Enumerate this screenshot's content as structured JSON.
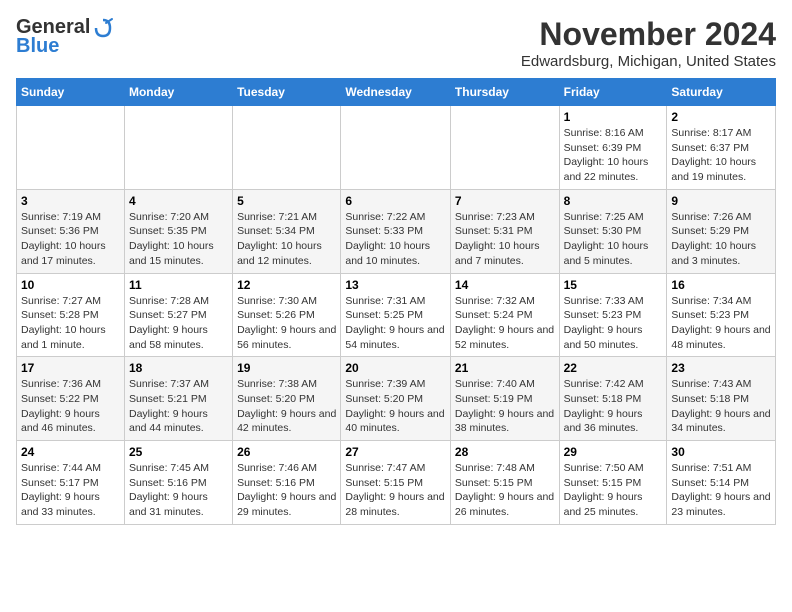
{
  "logo": {
    "general": "General",
    "blue": "Blue"
  },
  "title": "November 2024",
  "location": "Edwardsburg, Michigan, United States",
  "days_of_week": [
    "Sunday",
    "Monday",
    "Tuesday",
    "Wednesday",
    "Thursday",
    "Friday",
    "Saturday"
  ],
  "weeks": [
    [
      {
        "day": "",
        "info": ""
      },
      {
        "day": "",
        "info": ""
      },
      {
        "day": "",
        "info": ""
      },
      {
        "day": "",
        "info": ""
      },
      {
        "day": "",
        "info": ""
      },
      {
        "day": "1",
        "info": "Sunrise: 8:16 AM\nSunset: 6:39 PM\nDaylight: 10 hours and 22 minutes."
      },
      {
        "day": "2",
        "info": "Sunrise: 8:17 AM\nSunset: 6:37 PM\nDaylight: 10 hours and 19 minutes."
      }
    ],
    [
      {
        "day": "3",
        "info": "Sunrise: 7:19 AM\nSunset: 5:36 PM\nDaylight: 10 hours and 17 minutes."
      },
      {
        "day": "4",
        "info": "Sunrise: 7:20 AM\nSunset: 5:35 PM\nDaylight: 10 hours and 15 minutes."
      },
      {
        "day": "5",
        "info": "Sunrise: 7:21 AM\nSunset: 5:34 PM\nDaylight: 10 hours and 12 minutes."
      },
      {
        "day": "6",
        "info": "Sunrise: 7:22 AM\nSunset: 5:33 PM\nDaylight: 10 hours and 10 minutes."
      },
      {
        "day": "7",
        "info": "Sunrise: 7:23 AM\nSunset: 5:31 PM\nDaylight: 10 hours and 7 minutes."
      },
      {
        "day": "8",
        "info": "Sunrise: 7:25 AM\nSunset: 5:30 PM\nDaylight: 10 hours and 5 minutes."
      },
      {
        "day": "9",
        "info": "Sunrise: 7:26 AM\nSunset: 5:29 PM\nDaylight: 10 hours and 3 minutes."
      }
    ],
    [
      {
        "day": "10",
        "info": "Sunrise: 7:27 AM\nSunset: 5:28 PM\nDaylight: 10 hours and 1 minute."
      },
      {
        "day": "11",
        "info": "Sunrise: 7:28 AM\nSunset: 5:27 PM\nDaylight: 9 hours and 58 minutes."
      },
      {
        "day": "12",
        "info": "Sunrise: 7:30 AM\nSunset: 5:26 PM\nDaylight: 9 hours and 56 minutes."
      },
      {
        "day": "13",
        "info": "Sunrise: 7:31 AM\nSunset: 5:25 PM\nDaylight: 9 hours and 54 minutes."
      },
      {
        "day": "14",
        "info": "Sunrise: 7:32 AM\nSunset: 5:24 PM\nDaylight: 9 hours and 52 minutes."
      },
      {
        "day": "15",
        "info": "Sunrise: 7:33 AM\nSunset: 5:23 PM\nDaylight: 9 hours and 50 minutes."
      },
      {
        "day": "16",
        "info": "Sunrise: 7:34 AM\nSunset: 5:23 PM\nDaylight: 9 hours and 48 minutes."
      }
    ],
    [
      {
        "day": "17",
        "info": "Sunrise: 7:36 AM\nSunset: 5:22 PM\nDaylight: 9 hours and 46 minutes."
      },
      {
        "day": "18",
        "info": "Sunrise: 7:37 AM\nSunset: 5:21 PM\nDaylight: 9 hours and 44 minutes."
      },
      {
        "day": "19",
        "info": "Sunrise: 7:38 AM\nSunset: 5:20 PM\nDaylight: 9 hours and 42 minutes."
      },
      {
        "day": "20",
        "info": "Sunrise: 7:39 AM\nSunset: 5:20 PM\nDaylight: 9 hours and 40 minutes."
      },
      {
        "day": "21",
        "info": "Sunrise: 7:40 AM\nSunset: 5:19 PM\nDaylight: 9 hours and 38 minutes."
      },
      {
        "day": "22",
        "info": "Sunrise: 7:42 AM\nSunset: 5:18 PM\nDaylight: 9 hours and 36 minutes."
      },
      {
        "day": "23",
        "info": "Sunrise: 7:43 AM\nSunset: 5:18 PM\nDaylight: 9 hours and 34 minutes."
      }
    ],
    [
      {
        "day": "24",
        "info": "Sunrise: 7:44 AM\nSunset: 5:17 PM\nDaylight: 9 hours and 33 minutes."
      },
      {
        "day": "25",
        "info": "Sunrise: 7:45 AM\nSunset: 5:16 PM\nDaylight: 9 hours and 31 minutes."
      },
      {
        "day": "26",
        "info": "Sunrise: 7:46 AM\nSunset: 5:16 PM\nDaylight: 9 hours and 29 minutes."
      },
      {
        "day": "27",
        "info": "Sunrise: 7:47 AM\nSunset: 5:15 PM\nDaylight: 9 hours and 28 minutes."
      },
      {
        "day": "28",
        "info": "Sunrise: 7:48 AM\nSunset: 5:15 PM\nDaylight: 9 hours and 26 minutes."
      },
      {
        "day": "29",
        "info": "Sunrise: 7:50 AM\nSunset: 5:15 PM\nDaylight: 9 hours and 25 minutes."
      },
      {
        "day": "30",
        "info": "Sunrise: 7:51 AM\nSunset: 5:14 PM\nDaylight: 9 hours and 23 minutes."
      }
    ]
  ]
}
